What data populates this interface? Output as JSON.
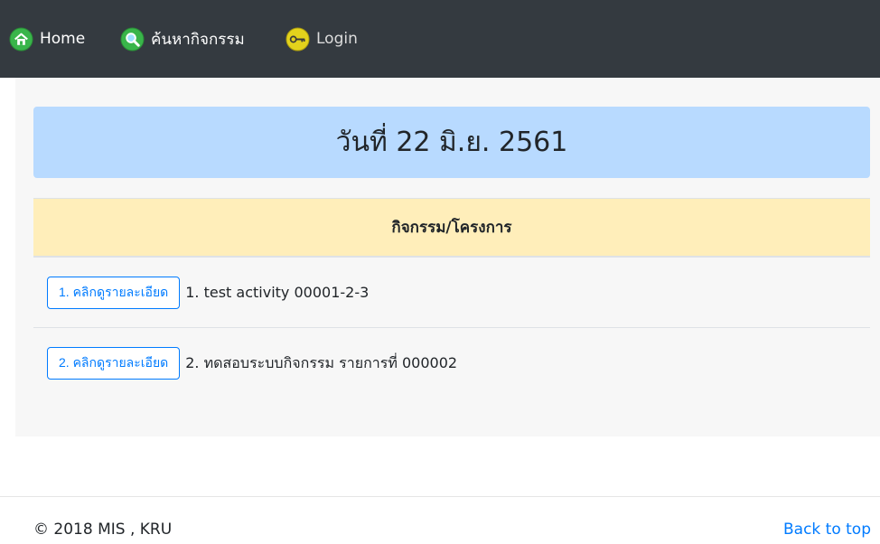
{
  "nav": {
    "home_label": "Home",
    "search_label": "ค้นหากิจกรรม",
    "login_label": "Login",
    "icons": [
      "home-icon",
      "search-icon",
      "key-icon"
    ],
    "background": "#343a40"
  },
  "date_banner": {
    "text": "วันที่ 22 มิ.ย. 2561",
    "background": "#b8daff"
  },
  "table": {
    "header": "กิจกรรม/โครงการ",
    "header_background": "#ffeeba",
    "rows": [
      {
        "button_label": "1. คลิกดูรายละเอียด",
        "title": "1. test activity 00001-2-3"
      },
      {
        "button_label": "2. คลิกดูรายละเอียด",
        "title": "2. ทดสอบระบบกิจกรรม รายการที่ 000002"
      }
    ]
  },
  "footer": {
    "copyright": "© 2018 MIS , KRU",
    "back_to_top": "Back to top"
  }
}
